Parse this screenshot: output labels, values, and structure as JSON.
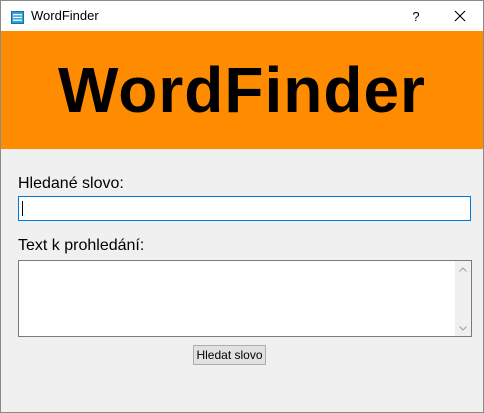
{
  "window": {
    "title": "WordFinder",
    "help_label": "?",
    "app_icon": "app-window-icon",
    "close_icon": "close-icon"
  },
  "banner": {
    "title": "WordFinder",
    "background": "#ff8c00"
  },
  "form": {
    "search_label": "Hledané slovo:",
    "search_value": "",
    "text_label": "Text k prohledání:",
    "text_value": "",
    "submit_label": "Hledat slovo"
  }
}
